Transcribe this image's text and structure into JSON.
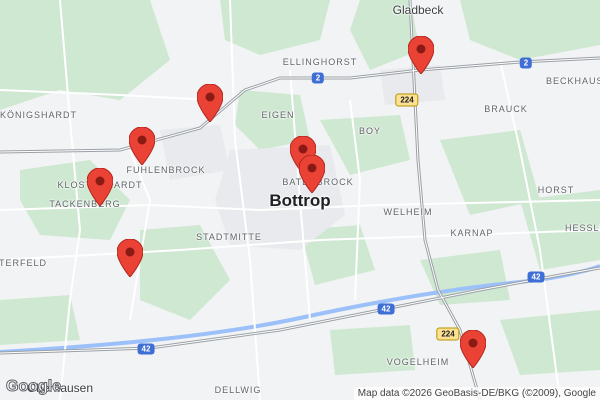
{
  "map": {
    "city": "Bottrop",
    "districts": [
      "Gladbeck",
      "Ellinghorst",
      "Eigen",
      "Boy",
      "Brauck",
      "Beckhausen",
      "Königshardt",
      "Fuhlenbrock",
      "Klosterhardt",
      "Tackenberg",
      "Batenbrock",
      "Welheim",
      "Horst",
      "Karnap",
      "Hessler",
      "Stadtmitte",
      "Osterfeld",
      "Vogelheim",
      "Dellwig",
      "Oberhausen"
    ],
    "roads": [
      "2",
      "2",
      "224",
      "42",
      "42",
      "42",
      "224"
    ],
    "markers": [
      "location-pin",
      "location-pin",
      "location-pin",
      "location-pin",
      "location-pin",
      "location-pin",
      "location-pin",
      "location-pin"
    ],
    "marker_color": "#ea4335",
    "attribution": "Map data ©2026 GeoBasis-DE/BKG (©2009), Google",
    "logo": "Google"
  }
}
